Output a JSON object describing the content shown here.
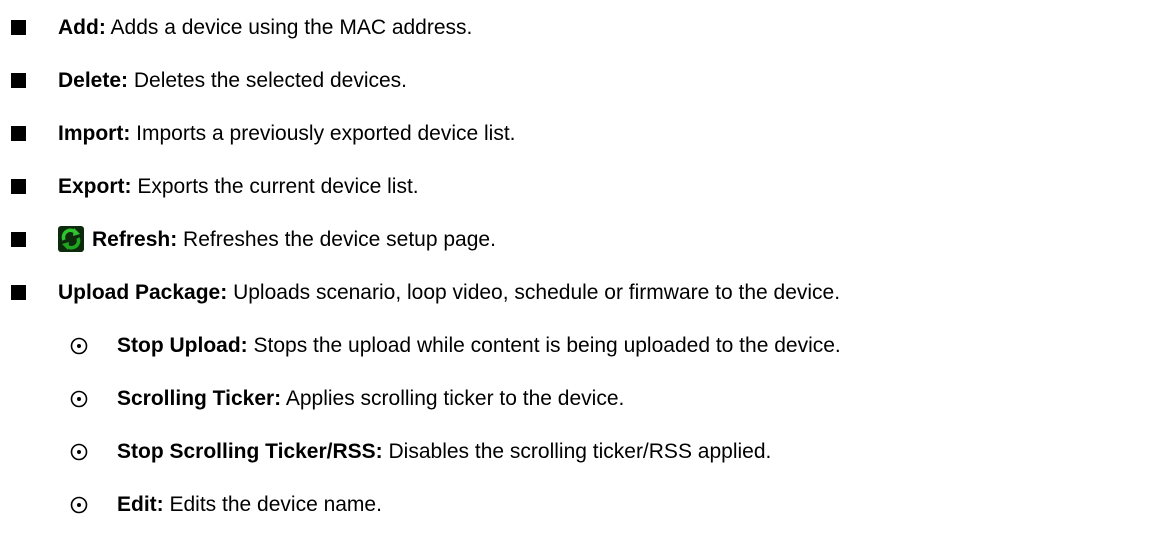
{
  "items": [
    {
      "term": "Add:",
      "desc": " Adds a device using the MAC address."
    },
    {
      "term": "Delete:",
      "desc": " Deletes the selected devices."
    },
    {
      "term": "Import:",
      "desc": " Imports a previously exported device list."
    },
    {
      "term": "Export:",
      "desc": " Exports the current device list."
    },
    {
      "icon": "refresh-icon",
      "term": "Refresh:",
      "desc": " Refreshes the device setup page."
    },
    {
      "term": "Upload Package:",
      "desc": " Uploads scenario, loop video, schedule or firmware to the device."
    }
  ],
  "subitems": [
    {
      "term": "Stop Upload:",
      "desc": " Stops the upload while content is being uploaded to the device."
    },
    {
      "term": "Scrolling Ticker:",
      "desc": " Applies scrolling ticker to the device."
    },
    {
      "term": "Stop Scrolling Ticker/RSS:",
      "desc": " Disables the scrolling ticker/RSS applied."
    },
    {
      "term": "Edit:",
      "desc": " Edits the device name."
    }
  ],
  "colors": {
    "text": "#000000",
    "icon_green": "#1fa51f",
    "icon_bg": "#0d2a0d"
  }
}
